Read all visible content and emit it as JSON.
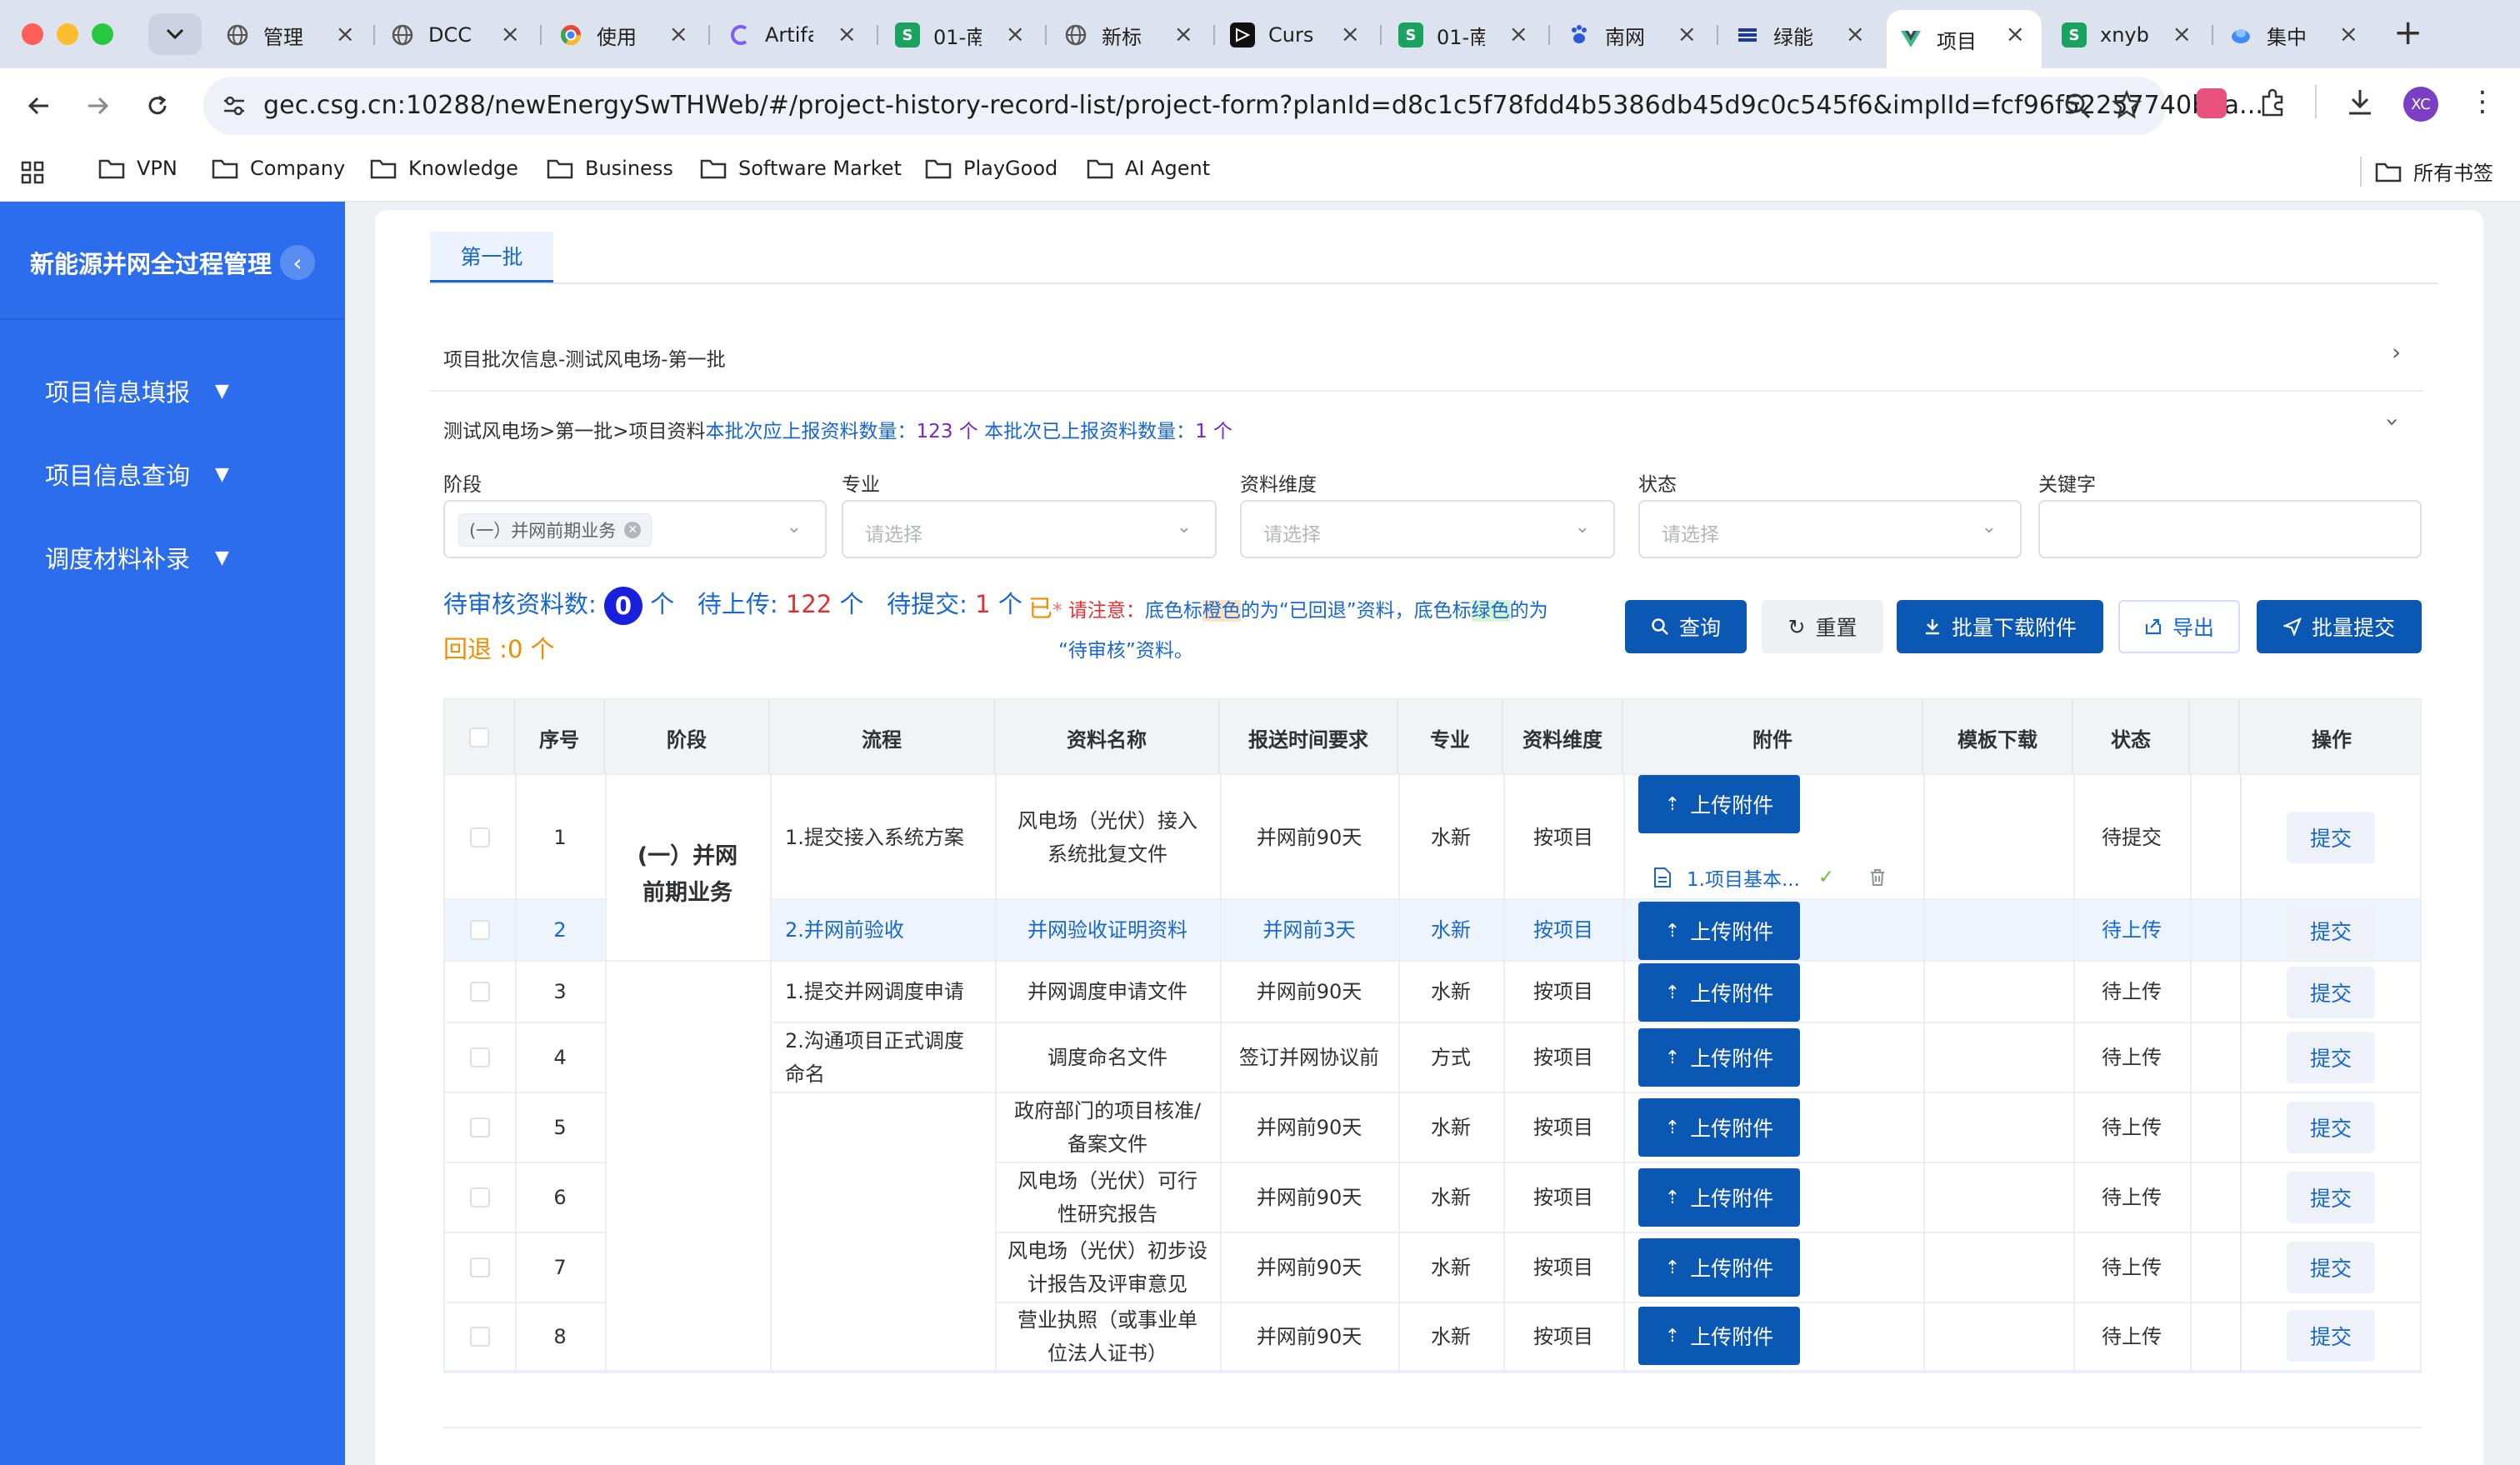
{
  "browser": {
    "tabs": [
      {
        "title": "管理",
        "icon": "globe-icon"
      },
      {
        "title": "DCC",
        "icon": "globe-icon"
      },
      {
        "title": "使用",
        "icon": "chrome-icon"
      },
      {
        "title": "Artifa",
        "icon": "c-logo-icon"
      },
      {
        "title": "01-南",
        "icon": "sheet-icon"
      },
      {
        "title": "新标",
        "icon": "globe-icon"
      },
      {
        "title": "Curs",
        "icon": "cursor-icon"
      },
      {
        "title": "01-南",
        "icon": "sheet-icon"
      },
      {
        "title": "南网",
        "icon": "paw-icon"
      },
      {
        "title": "绿能",
        "icon": "list-icon"
      },
      {
        "title": "项目",
        "icon": "vue-icon",
        "active": true
      },
      {
        "title": "xnyb",
        "icon": "sheet-icon"
      },
      {
        "title": "集中",
        "icon": "droplet-icon"
      }
    ],
    "url": "gec.csg.cn:10288/newEnergySwTHWeb/#/project-history-record-list/project-form?planId=d8c1c5f78fdd4b5386db45d9c0c545f6&implId=fcf96f52257740b3a...",
    "avatar_initials": "XC",
    "bookmarks": [
      "VPN",
      "Company",
      "Knowledge",
      "Business",
      "Software Market",
      "PlayGood",
      "AI Agent"
    ],
    "all_bookmarks": "所有书签"
  },
  "sidebar": {
    "title": "新能源并网全过程管理",
    "collapse_glyph": "‹",
    "items": [
      {
        "label": "项目信息填报"
      },
      {
        "label": "项目信息查询"
      },
      {
        "label": "调度材料补录"
      }
    ]
  },
  "page": {
    "tab": "第一批",
    "batch_header": "项目批次信息-测试风电场-第一批",
    "summary": {
      "path": "测试风电场>第一批>项目资料",
      "should_label": "本批次应上报资料数量：",
      "should_value": "123 个",
      "done_label": "本批次已上报资料数量：",
      "done_value": "1 个"
    },
    "filters": {
      "stage_label": "阶段",
      "stage_value": "(一）并网前期业务",
      "major_label": "专业",
      "major_placeholder": "请选择",
      "dimension_label": "资料维度",
      "dimension_placeholder": "请选择",
      "status_label": "状态",
      "status_placeholder": "请选择",
      "keyword_label": "关键字"
    },
    "stats": {
      "review_label": "待审核资料数:",
      "review_value": "0",
      "review_unit": "个",
      "upload_label": "待上传:",
      "upload_value": "122",
      "upload_unit": "个",
      "submit_label": "待提交:",
      "submit_value": "1",
      "submit_unit": "个",
      "returned": "回退 :0 个"
    },
    "notice": {
      "yi": "已",
      "star": "*",
      "please": "请注意：",
      "t1": "底色标",
      "orange": "橙色",
      "t2": "的为“已回退”资料，底色标",
      "green": "绿色",
      "t3": "的为",
      "t4": "“待审核”资料。"
    },
    "buttons": {
      "query": "查询",
      "reset": "重置",
      "batch_download": "批量下载附件",
      "export": "导出",
      "batch_submit": "批量提交"
    }
  },
  "table": {
    "headers": [
      "序号",
      "阶段",
      "流程",
      "资料名称",
      "报送时间要求",
      "专业",
      "资料维度",
      "附件",
      "模板下载",
      "状态",
      "操作"
    ],
    "stage_group": "(一）并网前期业务",
    "upload_label": "上传附件",
    "submit_label": "提交",
    "file_name": "1.项目基本...",
    "rows": [
      {
        "no": "1",
        "process": "1.提交接入系统方案",
        "name": "风电场（光伏）接入系统批复文件",
        "time": "并网前90天",
        "major": "水新",
        "dim": "按项目",
        "status": "待提交"
      },
      {
        "no": "2",
        "process": "2.并网前验收",
        "name": "并网验收证明资料",
        "time": "并网前3天",
        "major": "水新",
        "dim": "按项目",
        "status": "待上传"
      },
      {
        "no": "3",
        "process": "1.提交并网调度申请",
        "name": "并网调度申请文件",
        "time": "并网前90天",
        "major": "水新",
        "dim": "按项目",
        "status": "待上传"
      },
      {
        "no": "4",
        "process": "2.沟通项目正式调度命名",
        "name": "调度命名文件",
        "time": "签订并网协议前",
        "major": "方式",
        "dim": "按项目",
        "status": "待上传"
      },
      {
        "no": "5",
        "process": "",
        "name": "政府部门的项目核准/备案文件",
        "time": "并网前90天",
        "major": "水新",
        "dim": "按项目",
        "status": "待上传"
      },
      {
        "no": "6",
        "process": "",
        "name": "风电场（光伏）可行性研究报告",
        "time": "并网前90天",
        "major": "水新",
        "dim": "按项目",
        "status": "待上传"
      },
      {
        "no": "7",
        "process": "",
        "name": "风电场（光伏）初步设计报告及评审意见",
        "time": "并网前90天",
        "major": "水新",
        "dim": "按项目",
        "status": "待上传"
      },
      {
        "no": "8",
        "process": "",
        "name": "营业执照（或事业单位法人证书）",
        "time": "并网前90天",
        "major": "水新",
        "dim": "按项目",
        "status": "待上传"
      }
    ]
  },
  "colors": {
    "sidebar": "#2c6dee",
    "primary_button": "#0b57b4",
    "link": "#1767d2",
    "danger": "#e03131",
    "warning": "#f08c00"
  }
}
